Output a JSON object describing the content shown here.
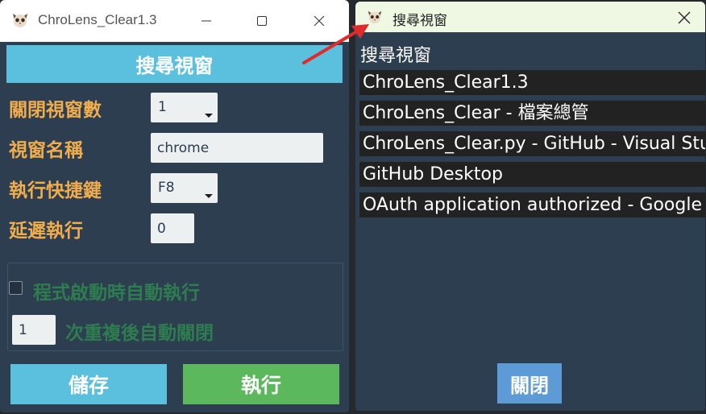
{
  "left_window": {
    "title": "ChroLens_Clear1.3",
    "header": "搜尋視窗",
    "labels": {
      "close_count": "關閉視窗數",
      "window_name": "視窗名稱",
      "hotkey": "執行快捷鍵",
      "delay": "延遲執行"
    },
    "values": {
      "close_count": "1",
      "window_name": "chrome",
      "hotkey": "F8",
      "delay": "0"
    },
    "options": {
      "autorun_label": "程式啟動時自動執行",
      "autorun_checked": false,
      "repeat_value": "1",
      "repeat_label": "次重複後自動關閉"
    },
    "buttons": {
      "save": "儲存",
      "run": "執行"
    }
  },
  "right_window": {
    "title": "搜尋視窗",
    "list_header": "搜尋視窗",
    "items": [
      "ChroLens_Clear1.3",
      "ChroLens_Clear - 檔案總管",
      "ChroLens_Clear.py - GitHub - Visual Studio Code",
      "GitHub Desktop",
      "OAuth application authorized - Google Chrome"
    ],
    "close_button": "關閉"
  },
  "colors": {
    "background": "#2c3e50",
    "info": "#5bc0de",
    "success": "#5cb85c",
    "warning": "#f0ad4e",
    "green_label": "#2e7d4f",
    "annotation": "#e02b2b"
  },
  "icons": {
    "app_icon": "cat-face-icon",
    "minimize": "minimize-icon",
    "maximize": "maximize-icon",
    "close": "close-icon",
    "dropdown": "triangle-down-icon"
  }
}
